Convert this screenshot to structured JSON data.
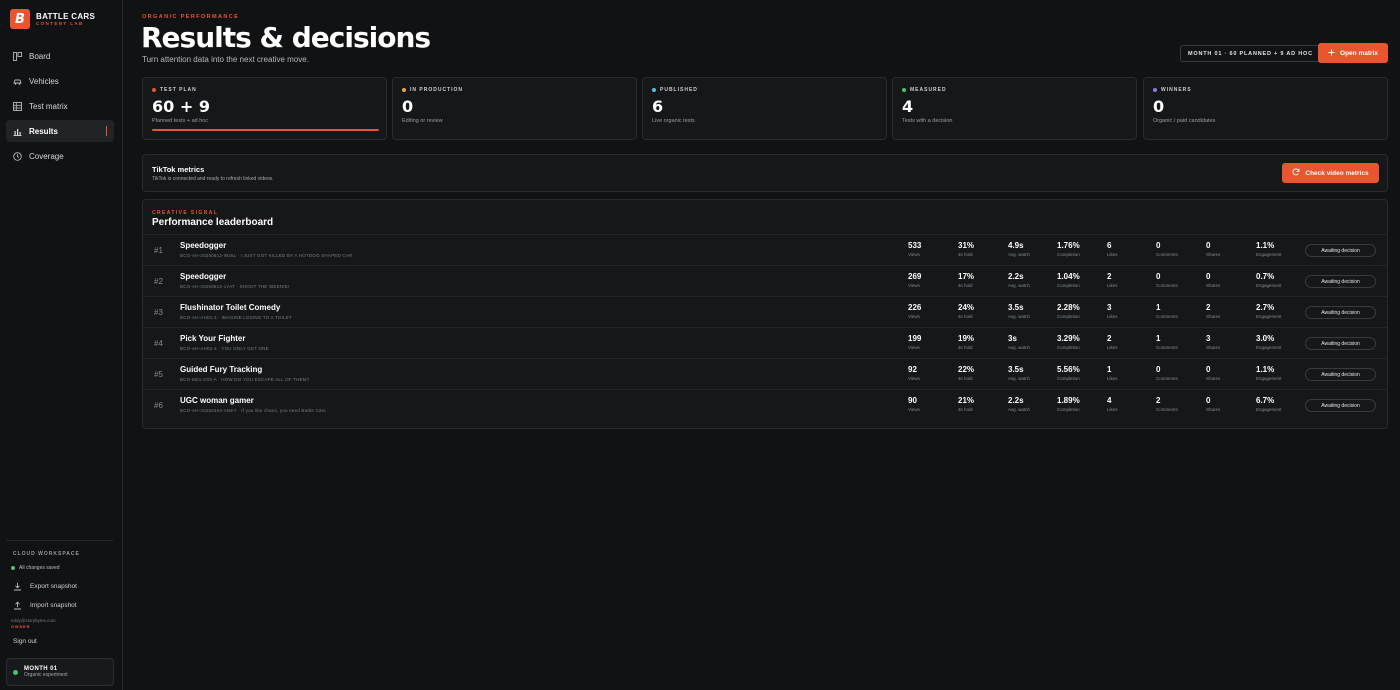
{
  "brand": {
    "logo_letter": "B",
    "name": "BATTLE CARS",
    "tagline": "CONTENT LAB"
  },
  "nav": {
    "items": [
      {
        "label": "Board",
        "icon": "board-icon",
        "active": false
      },
      {
        "label": "Vehicles",
        "icon": "car-icon",
        "active": false
      },
      {
        "label": "Test matrix",
        "icon": "grid-icon",
        "active": false
      },
      {
        "label": "Results",
        "icon": "bar-chart-icon",
        "active": true
      },
      {
        "label": "Coverage",
        "icon": "clock-icon",
        "active": false
      }
    ]
  },
  "cloud": {
    "title": "CLOUD WORKSPACE",
    "status": "All changes saved",
    "export_label": "Export snapshot",
    "import_label": "Import snapshot",
    "email": "eddy@storybytes.com",
    "role": "OWNER",
    "signout_label": "Sign out"
  },
  "month_box": {
    "title": "MONTH 01",
    "subtitle": "Organic experiment"
  },
  "header": {
    "eyebrow": "ORGANIC PERFORMANCE",
    "title": "Results & decisions",
    "subtitle": "Turn attention data into the next creative move.",
    "month_pill": "MONTH 01 · 60 PLANNED + 9 AD HOC",
    "open_matrix_label": "Open matrix"
  },
  "stats": [
    {
      "label": "TEST PLAN",
      "value": "60 + 9",
      "desc": "Planned tests + ad hoc",
      "dot": "#e8552f"
    },
    {
      "label": "IN PRODUCTION",
      "value": "0",
      "desc": "Editing or review",
      "dot": "#f0a23a"
    },
    {
      "label": "PUBLISHED",
      "value": "6",
      "desc": "Live organic tests",
      "dot": "#4ec3e0"
    },
    {
      "label": "MEASURED",
      "value": "4",
      "desc": "Tests with a decision",
      "dot": "#49c46b"
    },
    {
      "label": "WINNERS",
      "value": "0",
      "desc": "Organic / paid candidates",
      "dot": "#8f7bf0"
    }
  ],
  "tiktok": {
    "title": "TikTok metrics",
    "subtitle": "TikTok is connected and ready to refresh linked videos.",
    "button_label": "Check video metrics"
  },
  "leaderboard": {
    "eyebrow": "CREATIVE SIGNAL",
    "title": "Performance leaderboard",
    "metric_labels": [
      "Views",
      "3s hold",
      "Avg. watch",
      "Completion",
      "Likes",
      "Comments",
      "Shares",
      "Engagement"
    ],
    "rows": [
      {
        "rank": "#1",
        "name": "Speedogger",
        "sub": "BCO-AH-20260612-W26L · I JUST GOT KILLED BY A HOTDOG SHAPED CAR",
        "metrics": [
          "533",
          "31%",
          "4.9s",
          "1.76%",
          "6",
          "0",
          "0",
          "1.1%"
        ],
        "decision": "Awaiting decision"
      },
      {
        "rank": "#2",
        "name": "Speedogger",
        "sub": "BCO-AH-20260612-1YAT · SHOOT THE WEENIE!",
        "metrics": [
          "269",
          "17%",
          "2.2s",
          "1.04%",
          "2",
          "0",
          "0",
          "0.7%"
        ],
        "decision": "Awaiting decision"
      },
      {
        "rank": "#3",
        "name": "Flushinator Toilet Comedy",
        "sub": "BCO-AH-AH01-4 · IMAGINE LOSING TO A TOILET",
        "metrics": [
          "226",
          "24%",
          "3.5s",
          "2.28%",
          "3",
          "1",
          "2",
          "2.7%"
        ],
        "decision": "Awaiting decision"
      },
      {
        "rank": "#4",
        "name": "Pick Your Fighter",
        "sub": "BCO-AH-AH02-4 · YOU ONLY GET ONE",
        "metrics": [
          "199",
          "19%",
          "3s",
          "3.29%",
          "2",
          "1",
          "3",
          "3.0%"
        ],
        "decision": "Awaiting decision"
      },
      {
        "rank": "#5",
        "name": "Guided Fury Tracking",
        "sub": "BCO-M01-C03-A · HOW DO YOU ESCAPE ALL OF THEM?",
        "metrics": [
          "92",
          "22%",
          "3.5s",
          "5.56%",
          "1",
          "0",
          "0",
          "1.1%"
        ],
        "decision": "Awaiting decision"
      },
      {
        "rank": "#6",
        "name": "UGC woman gamer",
        "sub": "BCO-AH-20260404-ANEY · If you like chaos, you need Battle Cars",
        "metrics": [
          "90",
          "21%",
          "2.2s",
          "1.89%",
          "4",
          "2",
          "0",
          "6.7%"
        ],
        "decision": "Awaiting decision"
      }
    ]
  },
  "colors": {
    "accent": "#e8552f",
    "saved_dot": "#49c46b"
  }
}
